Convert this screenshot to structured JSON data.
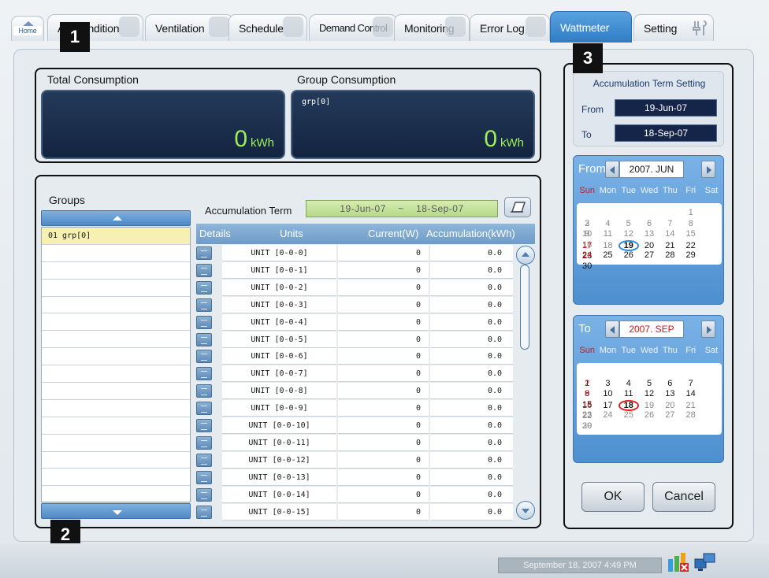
{
  "tabs": [
    {
      "label": "Home"
    },
    {
      "label": "Air-Condition"
    },
    {
      "label": "Ventilation"
    },
    {
      "label": "Schedule"
    },
    {
      "label": "Demand Control"
    },
    {
      "label": "Monitoring"
    },
    {
      "label": "Error Log"
    },
    {
      "label": "Wattmeter"
    },
    {
      "label": "Setting"
    }
  ],
  "callouts": {
    "one": "1",
    "two": "2",
    "three": "3"
  },
  "consumption": {
    "total_label": "Total Consumption",
    "total_value": "0",
    "total_unit": "kWh",
    "group_label": "Group Consumption",
    "group_name": "grp[0]",
    "group_value": "0",
    "group_unit": "kWh"
  },
  "groups": {
    "title": "Groups",
    "items": [
      {
        "text": "01   grp[0]"
      },
      {
        "text": ""
      },
      {
        "text": ""
      },
      {
        "text": ""
      },
      {
        "text": ""
      },
      {
        "text": ""
      },
      {
        "text": ""
      },
      {
        "text": ""
      },
      {
        "text": ""
      },
      {
        "text": ""
      },
      {
        "text": ""
      },
      {
        "text": ""
      },
      {
        "text": ""
      },
      {
        "text": ""
      },
      {
        "text": ""
      },
      {
        "text": ""
      }
    ]
  },
  "accumulation": {
    "label": "Accumulation Term",
    "from": "19-Jun-07",
    "sep": "~",
    "to": "18-Sep-07"
  },
  "table": {
    "headers": {
      "details": "Details",
      "units": "Units",
      "current": "Current(W)",
      "accumulation": "Accumulation(kWh)"
    },
    "rows": [
      {
        "unit": "UNIT [0-0-0]",
        "current": "0",
        "acc": "0.0"
      },
      {
        "unit": "UNIT [0-0-1]",
        "current": "0",
        "acc": "0.0"
      },
      {
        "unit": "UNIT [0-0-2]",
        "current": "0",
        "acc": "0.0"
      },
      {
        "unit": "UNIT [0-0-3]",
        "current": "0",
        "acc": "0.0"
      },
      {
        "unit": "UNIT [0-0-4]",
        "current": "0",
        "acc": "0.0"
      },
      {
        "unit": "UNIT [0-0-5]",
        "current": "0",
        "acc": "0.0"
      },
      {
        "unit": "UNIT [0-0-6]",
        "current": "0",
        "acc": "0.0"
      },
      {
        "unit": "UNIT [0-0-7]",
        "current": "0",
        "acc": "0.0"
      },
      {
        "unit": "UNIT [0-0-8]",
        "current": "0",
        "acc": "0.0"
      },
      {
        "unit": "UNIT [0-0-9]",
        "current": "0",
        "acc": "0.0"
      },
      {
        "unit": "UNIT [0-0-10]",
        "current": "0",
        "acc": "0.0"
      },
      {
        "unit": "UNIT [0-0-11]",
        "current": "0",
        "acc": "0.0"
      },
      {
        "unit": "UNIT [0-0-12]",
        "current": "0",
        "acc": "0.0"
      },
      {
        "unit": "UNIT [0-0-13]",
        "current": "0",
        "acc": "0.0"
      },
      {
        "unit": "UNIT [0-0-14]",
        "current": "0",
        "acc": "0.0"
      },
      {
        "unit": "UNIT [0-0-15]",
        "current": "0",
        "acc": "0.0"
      }
    ]
  },
  "term_setting": {
    "title": "Accumulation Term Setting",
    "from_label": "From",
    "from_value": "19-Jun-07",
    "to_label": "To",
    "to_value": "18-Sep-07"
  },
  "cal_from": {
    "label": "From",
    "month": "2007. JUN",
    "dow": [
      "Sun",
      "Mon",
      "Tue",
      "Wed",
      "Thu",
      "Fri",
      "Sat"
    ],
    "weeks": [
      [
        "",
        "",
        "",
        "",
        "",
        "1",
        "2"
      ],
      [
        "3",
        "4",
        "5",
        "6",
        "7",
        "8",
        "9"
      ],
      [
        "10",
        "11",
        "12",
        "13",
        "14",
        "15",
        "16"
      ],
      [
        "17",
        "18",
        "19",
        "20",
        "21",
        "22",
        "23"
      ],
      [
        "24",
        "25",
        "26",
        "27",
        "28",
        "29",
        "30"
      ]
    ],
    "selected_day": "19"
  },
  "cal_to": {
    "label": "To",
    "month": "2007. SEP",
    "dow": [
      "Sun",
      "Mon",
      "Tue",
      "Wed",
      "Thu",
      "Fri",
      "Sat"
    ],
    "weeks": [
      [
        "",
        "",
        "",
        "",
        "",
        "",
        "1"
      ],
      [
        "2",
        "3",
        "4",
        "5",
        "6",
        "7",
        "8"
      ],
      [
        "9",
        "10",
        "11",
        "12",
        "13",
        "14",
        "15"
      ],
      [
        "16",
        "17",
        "18",
        "19",
        "20",
        "21",
        "22"
      ],
      [
        "23",
        "24",
        "25",
        "26",
        "27",
        "28",
        "29"
      ],
      [
        "30",
        "",
        "",
        "",
        "",
        "",
        ""
      ]
    ],
    "selected_day": "18"
  },
  "buttons": {
    "ok": "OK",
    "cancel": "Cancel"
  },
  "status": {
    "datetime": "September 18, 2007 4:49 PM"
  },
  "colors": {
    "accent": "#2f7cc6",
    "value_green": "#9ef05a",
    "display_bg": "#1a2d4d",
    "callout": "#111111"
  },
  "icons": [
    "home-icon",
    "print-icon",
    "details-icon",
    "scroll-up-icon",
    "scroll-down-icon",
    "calendar-prev-icon",
    "calendar-next-icon",
    "chart-status-icon",
    "network-status-icon",
    "wrench-icon"
  ]
}
